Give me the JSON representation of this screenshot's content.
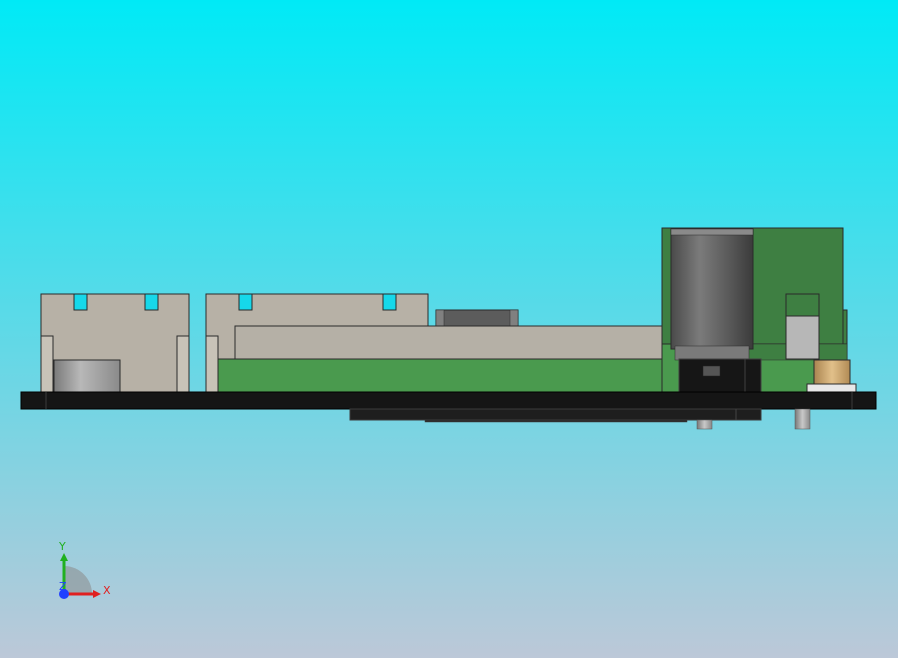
{
  "viewport": {
    "background_top": "#00eaf6",
    "background_bottom": "#bcc8d8"
  },
  "model": {
    "description_colors": {
      "board_black": "#151515",
      "pcb_green": "#4a9a4e",
      "pcb_dark_green": "#3e7f42",
      "connector_beige": "#b7b1a6",
      "connector_light": "#c8c3b8",
      "capacitor_grey": "#6e6e6e",
      "brass": "#c9a46c",
      "cutout_cyan": "#16d8ea"
    }
  },
  "triad": {
    "x_label": "X",
    "y_label": "Y",
    "z_label": "Z",
    "x_color": "#e02020",
    "y_color": "#20b020",
    "z_color": "#2040ff"
  }
}
